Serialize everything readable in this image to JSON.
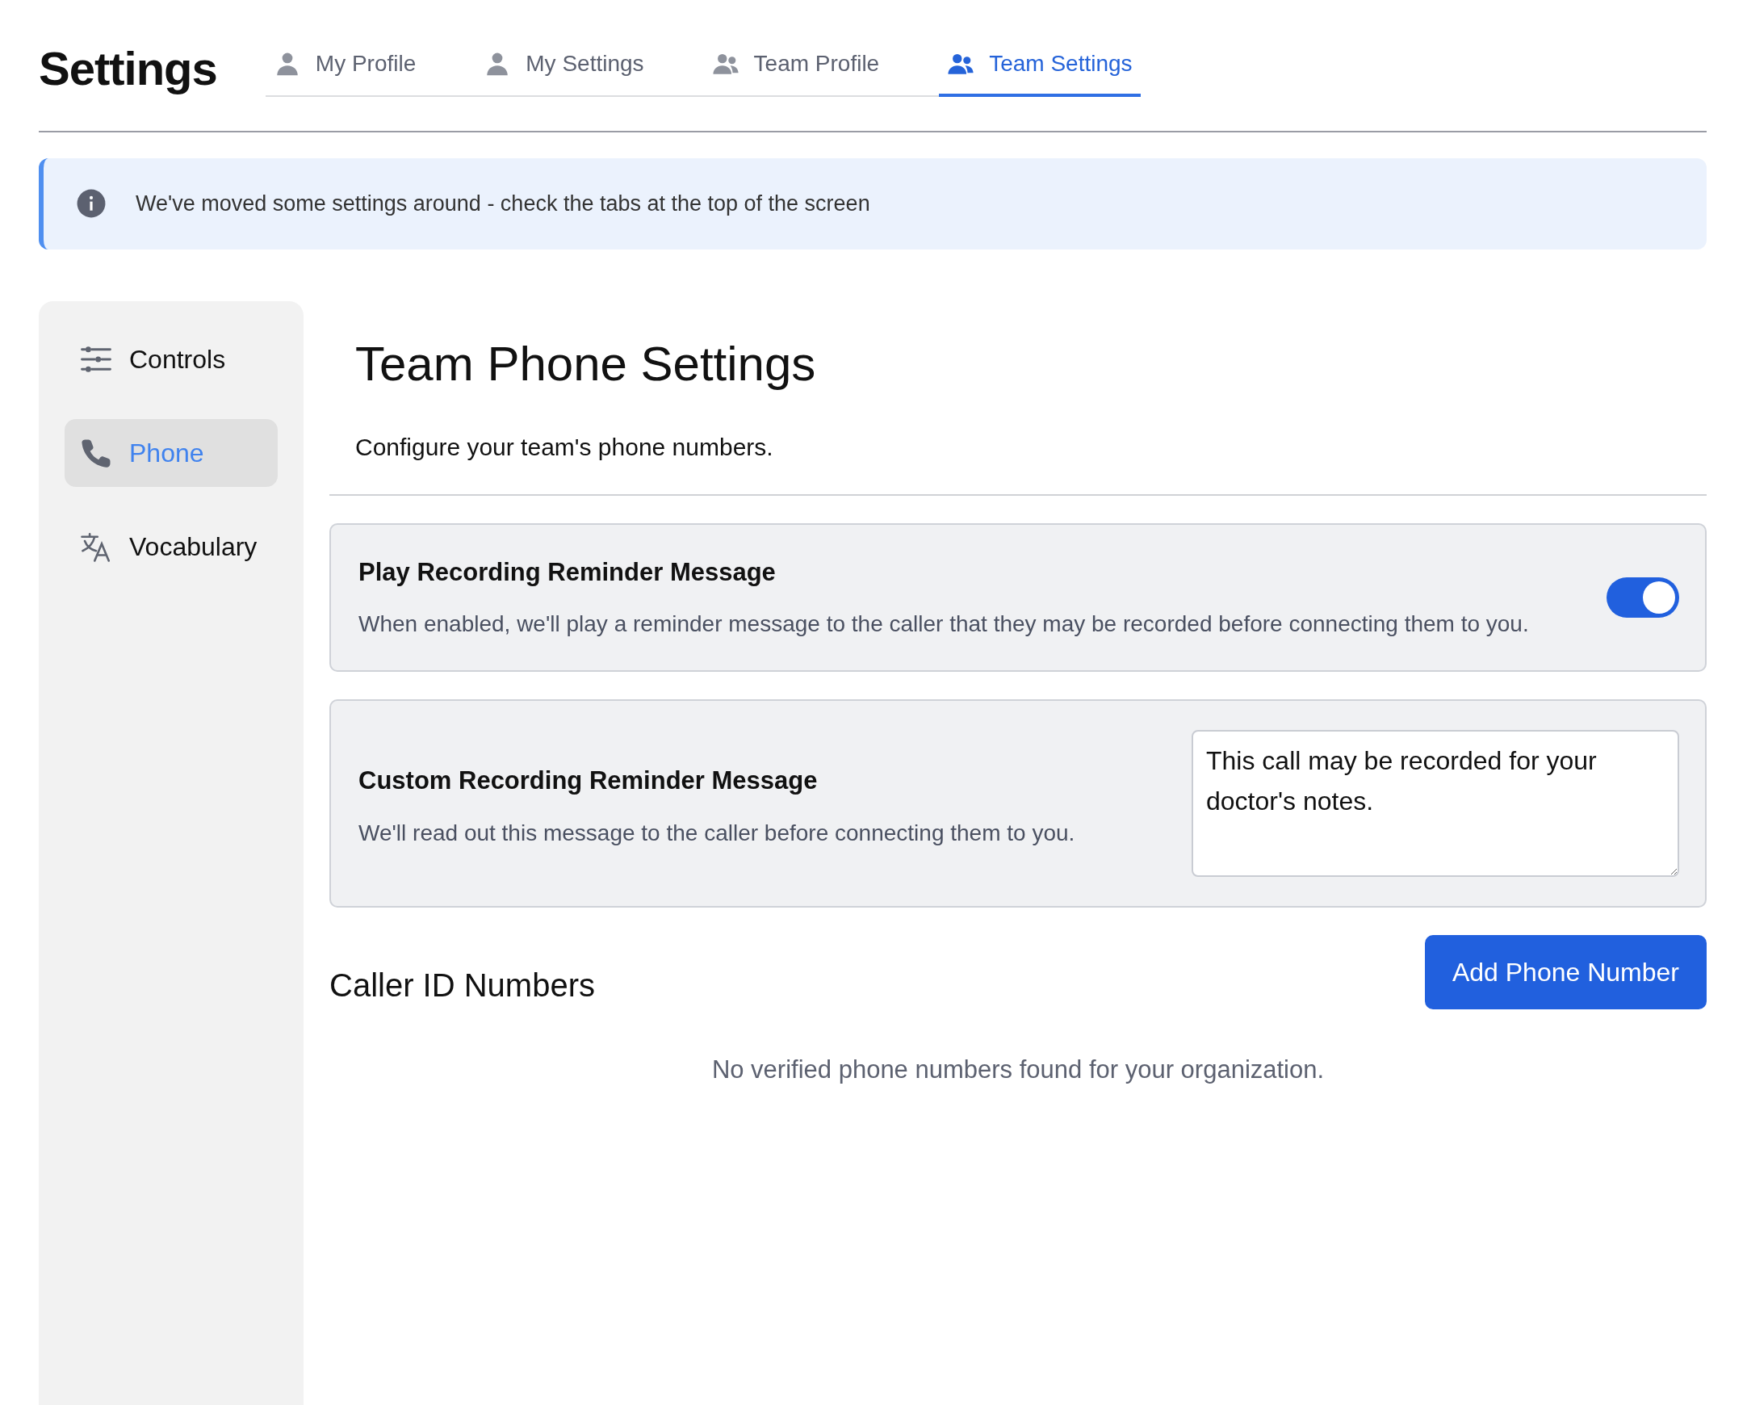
{
  "page_title": "Settings",
  "tabs": [
    {
      "label": "My Profile",
      "kind": "person",
      "selected": false
    },
    {
      "label": "My Settings",
      "kind": "person",
      "selected": false
    },
    {
      "label": "Team Profile",
      "kind": "people",
      "selected": false
    },
    {
      "label": "Team Settings",
      "kind": "people",
      "selected": true
    }
  ],
  "notice": {
    "text": "We've moved some settings around - check the tabs at the top of the screen"
  },
  "sidebar": {
    "items": [
      {
        "label": "Controls",
        "kind": "sliders",
        "selected": false
      },
      {
        "label": "Phone",
        "kind": "phone",
        "selected": true
      },
      {
        "label": "Vocabulary",
        "kind": "translate",
        "selected": false
      }
    ]
  },
  "content": {
    "title": "Team Phone Settings",
    "subtitle": "Configure your team's phone numbers.",
    "settings": [
      {
        "kind": "toggle",
        "title": "Play Recording Reminder Message",
        "description": "When enabled, we'll play a reminder message to the caller that they may be recorded before connecting them to you.",
        "on": true
      },
      {
        "kind": "textarea",
        "title": "Custom Recording Reminder Message",
        "description": "We'll read out this message to the caller before connecting them to you.",
        "value": "This call may be recorded for your doctor's notes."
      }
    ],
    "caller_id": {
      "title": "Caller ID Numbers",
      "button": "Add Phone Number",
      "empty_text": "No verified phone numbers found for your organization."
    }
  }
}
